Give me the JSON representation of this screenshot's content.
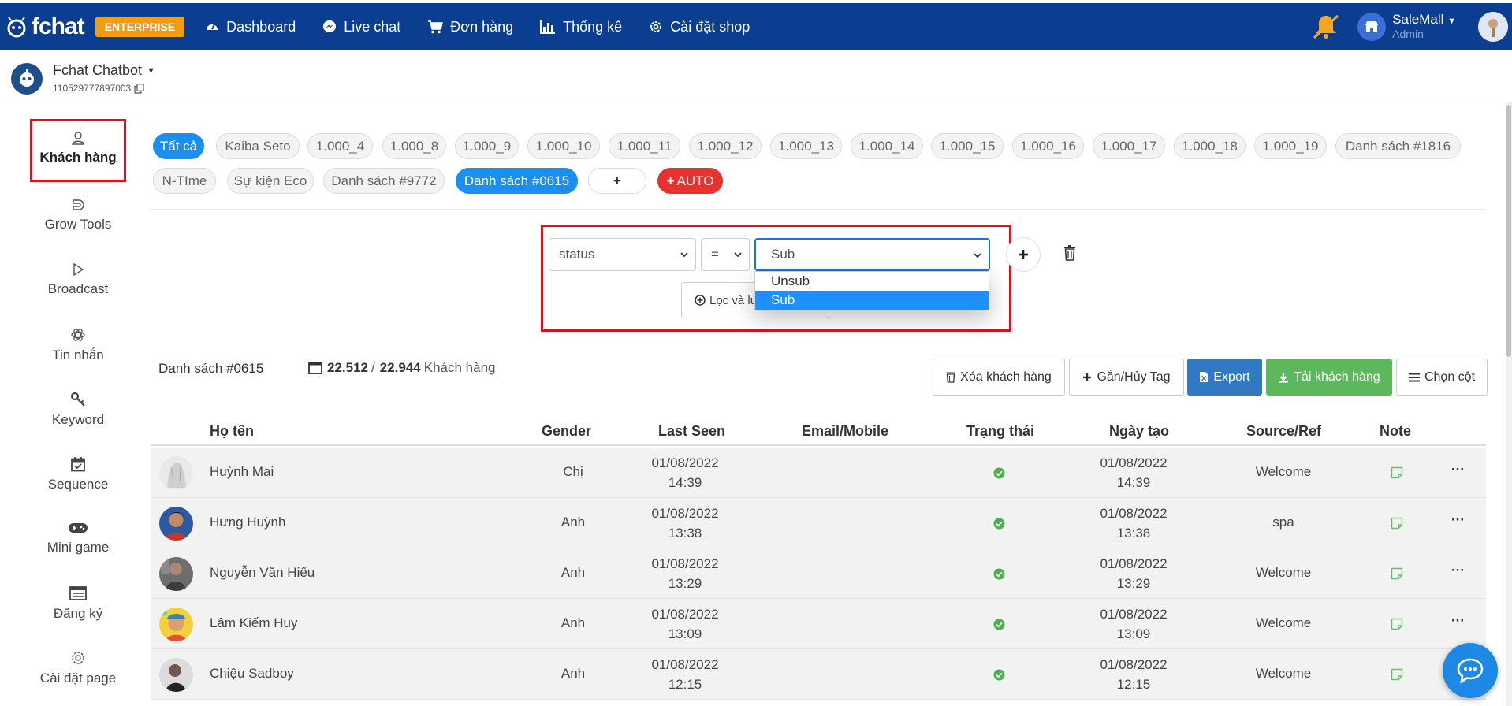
{
  "topbar": {
    "brand": "fchat",
    "badge": "ENTERPRISE",
    "nav": [
      {
        "label": "Dashboard",
        "icon": "speedometer-icon"
      },
      {
        "label": "Live chat",
        "icon": "messenger-icon"
      },
      {
        "label": "Đơn hàng",
        "icon": "cart-icon"
      },
      {
        "label": "Thống kê",
        "icon": "bar-chart-icon"
      },
      {
        "label": "Cài đặt shop",
        "icon": "gear-icon"
      }
    ],
    "user": {
      "name": "SaleMall",
      "role": "Admin"
    }
  },
  "page": {
    "bot_name": "Fchat Chatbot",
    "bot_id": "110529777897003"
  },
  "sidebar": {
    "items": [
      {
        "label": "Khách hàng",
        "icon": "user-icon"
      },
      {
        "label": "Grow Tools",
        "icon": "magnet-icon"
      },
      {
        "label": "Broadcast",
        "icon": "play-icon"
      },
      {
        "label": "Tin nhắn",
        "icon": "atom-icon"
      },
      {
        "label": "Keyword",
        "icon": "key-icon"
      },
      {
        "label": "Sequence",
        "icon": "calendar-check-icon"
      },
      {
        "label": "Mini game",
        "icon": "gamepad-icon"
      },
      {
        "label": "Đăng ký",
        "icon": "form-icon"
      },
      {
        "label": "Cài đặt page",
        "icon": "gear-icon"
      }
    ]
  },
  "tags": {
    "row1": [
      "Tất cả",
      "Kaiba Seto",
      "1.000_4",
      "1.000_8",
      "1.000_9",
      "1.000_10",
      "1.000_11",
      "1.000_12",
      "1.000_13",
      "1.000_14",
      "1.000_15",
      "1.000_16",
      "1.000_17",
      "1.000_18",
      "1.000_19",
      "Danh sách #1816"
    ],
    "row2": [
      "N-TIme",
      "Sự kiện Eco",
      "Danh sách #9772",
      "Danh sách #0615"
    ],
    "plus": "+",
    "auto": "AUTO"
  },
  "filter": {
    "field": "status",
    "operator": "=",
    "value": "Sub",
    "options": [
      "Unsub",
      "Sub"
    ],
    "save_label": "Lọc và lư"
  },
  "list": {
    "name": "Danh sách #0615",
    "count_shown": "22.512",
    "count_total": "22.944",
    "count_unit": "Khách hàng"
  },
  "actions": {
    "delete": "Xóa khách hàng",
    "tag": "Gắn/Hủy Tag",
    "export": "Export",
    "download": "Tải khách hàng",
    "columns": "Chọn cột"
  },
  "table": {
    "headers": {
      "name": "Họ tên",
      "gender": "Gender",
      "last_seen": "Last Seen",
      "email": "Email/Mobile",
      "status": "Trạng thái",
      "created": "Ngày tạo",
      "source": "Source/Ref",
      "note": "Note"
    },
    "rows": [
      {
        "name": "Huỳnh Mai",
        "gender": "Chị",
        "seen_date": "01/08/2022",
        "seen_time": "14:39",
        "created_date": "01/08/2022",
        "created_time": "14:39",
        "source": "Welcome"
      },
      {
        "name": "Hưng Huỳnh",
        "gender": "Anh",
        "seen_date": "01/08/2022",
        "seen_time": "13:38",
        "created_date": "01/08/2022",
        "created_time": "13:38",
        "source": "spa"
      },
      {
        "name": "Nguyễn Văn Hiếu",
        "gender": "Anh",
        "seen_date": "01/08/2022",
        "seen_time": "13:29",
        "created_date": "01/08/2022",
        "created_time": "13:29",
        "source": "Welcome"
      },
      {
        "name": "Lâm Kiếm Huy",
        "gender": "Anh",
        "seen_date": "01/08/2022",
        "seen_time": "13:09",
        "created_date": "01/08/2022",
        "created_time": "13:09",
        "source": "Welcome"
      },
      {
        "name": "Chiệu Sadboy",
        "gender": "Anh",
        "seen_date": "01/08/2022",
        "seen_time": "12:15",
        "created_date": "01/08/2022",
        "created_time": "12:15",
        "source": "Welcome"
      }
    ],
    "more": "···"
  },
  "colors": {
    "topbar": "#0b3d91",
    "accent": "#1b8ef2",
    "danger": "#e8322e",
    "success": "#5cb85c",
    "highlight": "#e0101a"
  }
}
